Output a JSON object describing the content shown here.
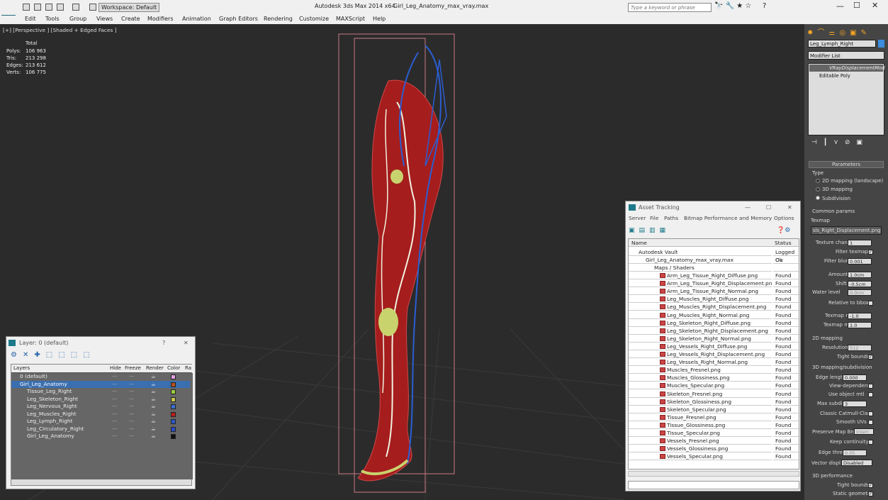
{
  "app": {
    "title": "Autodesk 3ds Max  2014 x64",
    "file": "Girl_Leg_Anatomy_max_vray.max",
    "workspace": "Workspace: Default",
    "search_placeholder": "Type a keyword or phrase"
  },
  "menu": [
    "Edit",
    "Tools",
    "Group",
    "Views",
    "Create",
    "Modifiers",
    "Animation",
    "Graph Editors",
    "Rendering",
    "Customize",
    "MAXScript",
    "Help"
  ],
  "viewport": {
    "label": "[+] [Perspective ] [Shaded + Edged Faces ]",
    "stats": {
      "header": "Total",
      "rows": [
        {
          "label": "Polys:",
          "value": "106 963"
        },
        {
          "label": "Tris:",
          "value": "213 298"
        },
        {
          "label": "Edges:",
          "value": "213 612"
        },
        {
          "label": "Verts:",
          "value": "106 775"
        }
      ]
    }
  },
  "layer_window": {
    "title": "Layer: 0 (default)",
    "columns": [
      "Layers",
      "Hide",
      "Freeze",
      "Render",
      "Color",
      "Ra"
    ],
    "rows": [
      {
        "name": "0 (default)",
        "indent": 1,
        "color": "#e2a0e2",
        "selected": false
      },
      {
        "name": "Girl_Leg_Anatomy",
        "indent": 1,
        "color": "#b4501e",
        "selected": true
      },
      {
        "name": "Tissue_Leg_Right",
        "indent": 2,
        "color": "#9ccf3c",
        "selected": false
      },
      {
        "name": "Leg_Skeleton_Right",
        "indent": 2,
        "color": "#c7c54a",
        "selected": false
      },
      {
        "name": "Leg_Nervous_Right",
        "indent": 2,
        "color": "#3c6fd2",
        "selected": false
      },
      {
        "name": "Leg_Muscles_Right",
        "indent": 2,
        "color": "#b41e1e",
        "selected": false
      },
      {
        "name": "Leg_Lymph_Right",
        "indent": 2,
        "color": "#2a5ac8",
        "selected": false
      },
      {
        "name": "Leg_Circulatory_Right",
        "indent": 2,
        "color": "#2a4fc8",
        "selected": false
      },
      {
        "name": "Girl_Leg_Anatomy",
        "indent": 2,
        "color": "#111111",
        "selected": false
      }
    ]
  },
  "asset_window": {
    "title": "Asset Tracking",
    "menu": [
      "Server",
      "File",
      "Paths",
      "Bitmap Performance and Memory",
      "Options"
    ],
    "columns": [
      "Name",
      "Status"
    ],
    "vault": {
      "name": "Autodesk Vault",
      "status": "Logged Ou"
    },
    "file": {
      "name": "Girl_Leg_Anatomy_max_vray.max",
      "status": "Ok"
    },
    "group": "Maps / Shaders",
    "assets": [
      {
        "name": "Arm_Leg_Tissue_Right_Diffuse.png",
        "status": "Found"
      },
      {
        "name": "Arm_Leg_Tissue_Right_Displacement.png",
        "status": "Found"
      },
      {
        "name": "Arm_Leg_Tissue_Right_Normal.png",
        "status": "Found"
      },
      {
        "name": "Leg_Muscles_Right_Diffuse.png",
        "status": "Found"
      },
      {
        "name": "Leg_Muscles_Right_Displacement.png",
        "status": "Found"
      },
      {
        "name": "Leg_Muscles_Right_Normal.png",
        "status": "Found"
      },
      {
        "name": "Leg_Skeleton_Right_Diffuse.png",
        "status": "Found"
      },
      {
        "name": "Leg_Skeleton_Right_Displacement.png",
        "status": "Found"
      },
      {
        "name": "Leg_Skeleton_Right_Normal.png",
        "status": "Found"
      },
      {
        "name": "Leg_Vessels_Right_Diffuse.png",
        "status": "Found"
      },
      {
        "name": "Leg_Vessels_Right_Displacement.png",
        "status": "Found"
      },
      {
        "name": "Leg_Vessels_Right_Normal.png",
        "status": "Found"
      },
      {
        "name": "Muscles_Fresnel.png",
        "status": "Found"
      },
      {
        "name": "Muscles_Glossiness.png",
        "status": "Found"
      },
      {
        "name": "Muscles_Specular.png",
        "status": "Found"
      },
      {
        "name": "Skeleton_Fresnel.png",
        "status": "Found"
      },
      {
        "name": "Skeleton_Glossiness.png",
        "status": "Found"
      },
      {
        "name": "Skeleton_Specular.png",
        "status": "Found"
      },
      {
        "name": "Tissue_Fresnel.png",
        "status": "Found"
      },
      {
        "name": "Tissue_Glossiness.png",
        "status": "Found"
      },
      {
        "name": "Tissue_Specular.png",
        "status": "Found"
      },
      {
        "name": "Vessels_Fresnel.png",
        "status": "Found"
      },
      {
        "name": "Vessels_Glossiness.png",
        "status": "Found"
      },
      {
        "name": "Vessels_Specular.png",
        "status": "Found"
      }
    ]
  },
  "command_panel": {
    "object_name": "Leg_Lymph_Right",
    "modifier_list": "Modifier List",
    "stack": [
      "VRayDisplacementMod",
      "Editable Poly"
    ],
    "rollout_title": "Parameters",
    "type_label": "Type",
    "type_options": [
      "2D mapping (landscape)",
      "3D mapping",
      "Subdivision"
    ],
    "common_params": "Common params",
    "texmap_label": "Texmap",
    "texmap_value": "sls_Right_Displacement.png)",
    "texture_chan": {
      "label": "Texture chan",
      "value": "1"
    },
    "filter_texmap": "Filter texmap",
    "filter_blur": {
      "label": "Filter blur",
      "value": "0.001"
    },
    "amount": {
      "label": "Amount",
      "value": "1.0cm"
    },
    "shift": {
      "label": "Shift",
      "value": "-0.5cm"
    },
    "water_level": {
      "label": "Water level",
      "value": "0.0cm"
    },
    "relative_bbox": "Relative to bbox",
    "texmap_min": {
      "label": "Texmap min",
      "value": "-1.0"
    },
    "texmap_max": {
      "label": "Texmap max",
      "value": "1.0"
    },
    "mapping_2d": "2D mapping",
    "resolution": {
      "label": "Resolution",
      "value": "512"
    },
    "tight_bounds": "Tight bounds",
    "mapping_3d": "3D mapping/subdivision",
    "edge_length": {
      "label": "Edge length",
      "value": "0.000"
    },
    "view_dependent": "View-dependent",
    "use_object_mtl": "Use object mtl",
    "max_subdivs": {
      "label": "Max subdivs",
      "value": "3"
    },
    "classic_cc": "Classic Catmull-Clark",
    "smooth_uvs": "Smooth UVs",
    "preserve_map_bnd": {
      "label": "Preserve Map Bnd",
      "value": "Interr"
    },
    "keep_continuity": "Keep continuity",
    "edge_thresh": {
      "label": "Edge thresh",
      "value": "0.05"
    },
    "vector_displ": {
      "label": "Vector displ",
      "value": "Disabled"
    },
    "performance": "3D performance",
    "tight_bounds_2": "Tight bounds",
    "static_geometry": "Static geometry"
  }
}
